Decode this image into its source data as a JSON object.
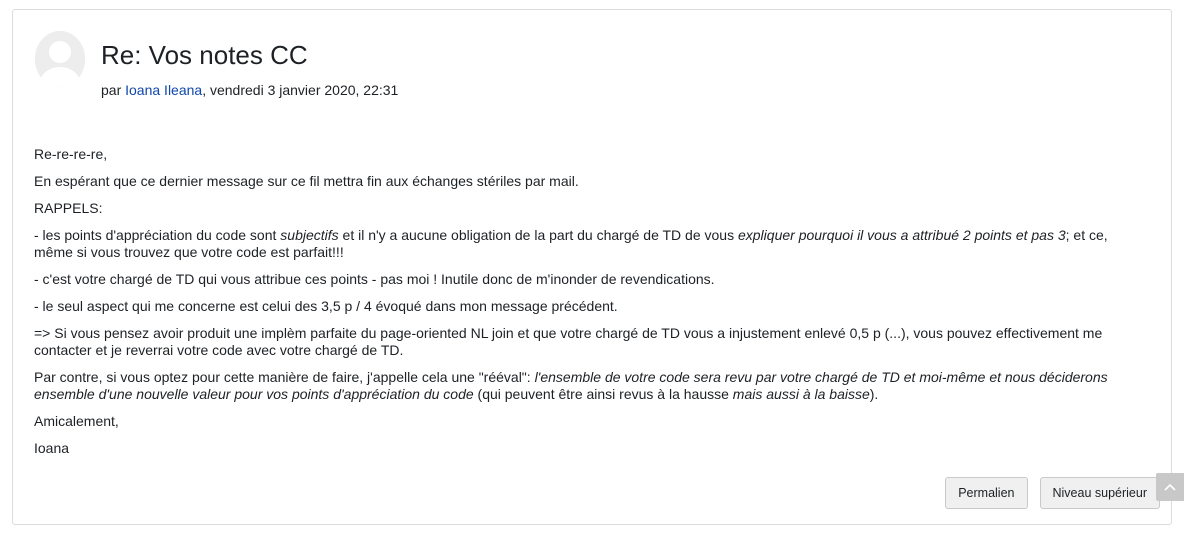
{
  "post": {
    "title": "Re: Vos notes CC",
    "byline_prefix": "par ",
    "author": "Ioana Ileana",
    "date": ", vendredi 3 janvier 2020, 22:31",
    "paragraphs": [
      [
        {
          "t": "Re-re-re-re,"
        }
      ],
      [
        {
          "t": "En espérant que ce dernier message sur ce fil mettra fin aux échanges stériles par mail."
        }
      ],
      [
        {
          "t": "RAPPELS:"
        }
      ],
      [
        {
          "t": "- les points d'appréciation du code sont "
        },
        {
          "t": "subjectifs",
          "i": true
        },
        {
          "t": " et il n'y a aucune obligation de la part du chargé de TD de vous "
        },
        {
          "t": "expliquer pourquoi il vous a attribué 2 points et pas 3",
          "i": true
        },
        {
          "t": "; et ce, même si vous trouvez que votre code est parfait!!!"
        }
      ],
      [
        {
          "t": "- c'est votre chargé de TD qui vous attribue ces points - pas moi ! Inutile donc de m'inonder de revendications."
        }
      ],
      [
        {
          "t": "- le seul aspect qui me concerne est celui des 3,5 p / 4 évoqué dans mon message précédent."
        }
      ],
      [
        {
          "t": "=> Si vous pensez avoir produit une implèm parfaite du page-oriented NL join et que votre chargé de TD vous a injustement enlevé 0,5 p (...), vous pouvez effectivement me contacter et je reverrai votre code avec votre chargé de TD."
        }
      ],
      [
        {
          "t": "Par contre, si vous optez pour cette manière de faire, j'appelle cela une \"rééval\": "
        },
        {
          "t": "l'ensemble de votre code sera revu par votre chargé de TD et moi-même et nous déciderons ensemble d'une nouvelle valeur pour vos points d'appréciation du code",
          "i": true
        },
        {
          "t": " (qui peuvent être ainsi revus à la hausse "
        },
        {
          "t": "mais aussi à la baisse",
          "i": true
        },
        {
          "t": ")."
        }
      ],
      [
        {
          "t": "Amicalement,"
        }
      ],
      [
        {
          "t": "Ioana"
        }
      ]
    ]
  },
  "actions": {
    "permalink_label": "Permalien",
    "parent_label": "Niveau supérieur"
  },
  "icons": {
    "avatar": "default-user-avatar-icon",
    "scroll_top": "chevron-up-icon"
  },
  "colors": {
    "link": "#0f47ad",
    "border": "#dcdcdc",
    "button_bg": "#f0f0f0"
  }
}
